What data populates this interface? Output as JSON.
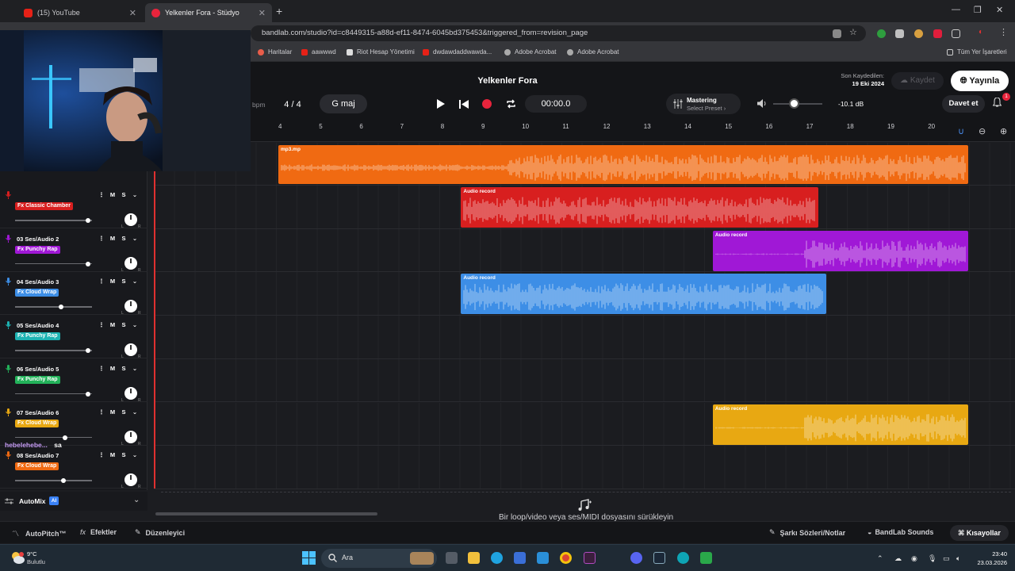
{
  "browser": {
    "tabs": [
      {
        "title": "(15) YouTube",
        "active": false
      },
      {
        "title": "Yelkenler Fora - Stüdyo",
        "active": true
      }
    ],
    "url": "bandlab.com/studio?id=c8449315-a88d-ef11-8474-6045bd375453&triggered_from=revision_page",
    "bookmarks": [
      "Haritalar",
      "aawwwd",
      "Riot Hesap Yönetimi",
      "dwdawdaddwawda...",
      "Adobe Acrobat",
      "Adobe Acrobat"
    ],
    "all_bookmarks": "Tüm Yer İşaretleri"
  },
  "header": {
    "title": "Yelkenler Fora",
    "saved_label": "Son Kaydedilen:",
    "saved_date": "19 Eki 2024",
    "save_button": "Kaydet",
    "publish_button": "Yayınla",
    "invite_button": "Davet et",
    "notification_count": "1"
  },
  "transport": {
    "bpm_label": "bpm",
    "time_signature": "4 / 4",
    "key": "G maj",
    "time": "00:00.0",
    "mastering_title": "Mastering",
    "mastering_preset": "Select Preset",
    "volume_db": "-10.1 dB",
    "volume_level": 0.42
  },
  "ruler": {
    "ticks": [
      "4",
      "5",
      "6",
      "7",
      "8",
      "9",
      "10",
      "11",
      "12",
      "13",
      "14",
      "15",
      "16",
      "17",
      "18",
      "19",
      "20"
    ]
  },
  "tracks": [
    {
      "name": "",
      "fx": "",
      "color": "#f06a12",
      "clip_label": "mp3.mp",
      "clip_start": 4,
      "clip_end": 21,
      "pan": 0.85
    },
    {
      "name": "",
      "fx": "Fx Classic Chamber",
      "color": "#d81f1f",
      "clip_label": "Audio record",
      "clip_start": 8.5,
      "clip_end": 17.3,
      "pan": 0.95
    },
    {
      "name": "03  Ses/Audio 2",
      "fx": "Fx Punchy Rap",
      "color": "#a018d6",
      "clip_label": "Audio record",
      "clip_start": 14.7,
      "clip_end": 21,
      "pan": 0.95
    },
    {
      "name": "04  Ses/Audio 3",
      "fx": "Fx Cloud Wrap",
      "color": "#3d8ee6",
      "clip_label": "Audio record",
      "clip_start": 8.5,
      "clip_end": 17.5,
      "pan": 0.6
    },
    {
      "name": "05  Ses/Audio 4",
      "fx": "Fx Punchy Rap",
      "color": "#1eb3b3",
      "clip_label": "",
      "clip_start": 0,
      "clip_end": 0,
      "pan": 0.95
    },
    {
      "name": "06  Ses/Audio 5",
      "fx": "Fx Punchy Rap",
      "color": "#23b25a",
      "clip_label": "",
      "clip_start": 0,
      "clip_end": 0,
      "pan": 0.95
    },
    {
      "name": "07  Ses/Audio 6",
      "fx": "Fx Cloud Wrap",
      "color": "#e8a812",
      "clip_label": "Audio record",
      "clip_start": 14.7,
      "clip_end": 21,
      "pan": 0.65
    },
    {
      "name": "08  Ses/Audio 7",
      "fx": "Fx Cloud Wrap",
      "color": "#f06a12",
      "clip_label": "",
      "clip_start": 0,
      "clip_end": 0,
      "pan": 0.63
    }
  ],
  "track_buttons": {
    "mute": "M",
    "solo": "S"
  },
  "automix": {
    "label": "AutoMix",
    "badge": "AI"
  },
  "chat": {
    "user": "hebelehebe...",
    "message": "sa"
  },
  "dropzone": {
    "text": "Bir loop/video veya ses/MIDI dosyasını sürükleyin"
  },
  "bottombar": {
    "autopitch": "AutoPitch™",
    "effects": "Efektler",
    "editor": "Düzenleyici",
    "lyrics": "Şarkı Sözleri/Notlar",
    "sounds": "BandLab Sounds",
    "shortcuts": "Kısayollar"
  },
  "taskbar": {
    "temperature": "9°C",
    "weather": "Bulutlu",
    "search": "Ara",
    "time": "23:40",
    "date": "23.03.2026"
  }
}
